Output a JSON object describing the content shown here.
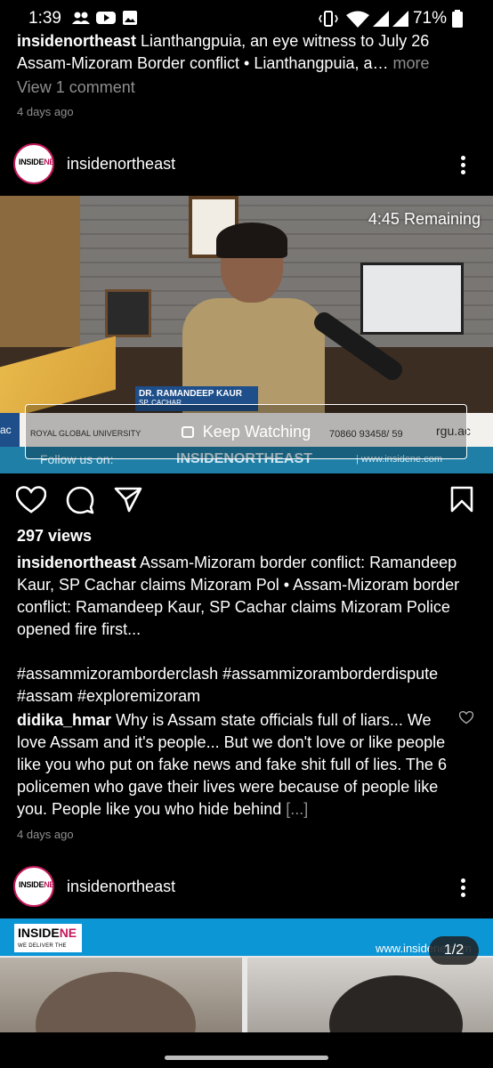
{
  "status_bar": {
    "time": "1:39",
    "battery": "71%"
  },
  "prev_post": {
    "username": "insidenortheast",
    "caption_text": "Lianthangpuia, an eye witness to July 26 Assam-Mizoram Border conflict • Lianthangpuia, a…",
    "more": " more",
    "view_comments": "View 1 comment",
    "time_ago": "4 days ago"
  },
  "post": {
    "username": "insidenortheast",
    "avatar_text_a": "INSIDE",
    "avatar_text_b": "NE",
    "video": {
      "remaining": "4:45 Remaining",
      "lower_third_name": "DR. RAMANDEEP KAUR",
      "lower_third_title": "SP, CACHAR",
      "ticker_left": "ac",
      "ticker_uni": "ROYAL GLOBAL UNIVERSITY",
      "ticker_phone": "70860 93458/ 59",
      "ticker_site": "rgu.ac",
      "keep_watching": "Keep Watching",
      "follow_text": "Follow us on:",
      "follow_handle": "INSIDENORTHEAST",
      "follow_url": "| www.insidene.com"
    },
    "views": "297 views",
    "caption_username": "insidenortheast",
    "caption_text": "Assam-Mizoram border conflict: Ramandeep Kaur, SP Cachar claims Mizoram Pol • Assam-Mizoram border conflict: Ramandeep Kaur, SP Cachar claims Mizoram Police opened fire first...",
    "hashtags_line1": "#assammizoramborderclash #assammizoramborderdispute",
    "hashtags_line2": "#assam #exploremizoram",
    "comment_username": "didika_hmar",
    "comment_text": "Why is Assam state officials full of liars... We love Assam and it's people... But we don't love or like people like you who put on fake news and fake shit full of lies. The 6 policemen who gave their lives were because of people like you. People like you who hide behind",
    "comment_more": "[...]",
    "time_ago": "4 days ago"
  },
  "next_post": {
    "username": "insidenortheast",
    "logo_a": "INSIDE",
    "logo_b": "NE",
    "logo_tag": "WE DELIVER THE NORTHEAST",
    "url": "www.insidene.com",
    "pager": "1/2"
  },
  "icons": {
    "like": "heart-icon",
    "comment": "comment-icon",
    "share": "send-icon",
    "save": "bookmark-icon"
  }
}
